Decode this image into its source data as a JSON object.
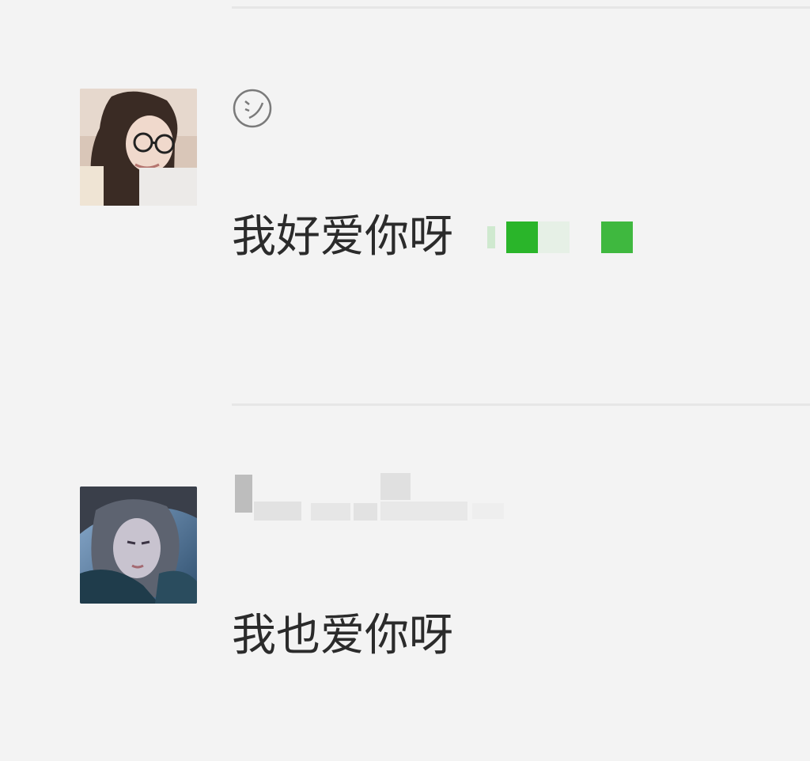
{
  "chat": {
    "messages": [
      {
        "avatar_icon": "female-avatar-icon",
        "name_icon": "smile-icon",
        "text": "我好爱你呀",
        "redacted_emoji_colors": [
          "#2ab52a",
          "#3fb83f"
        ]
      },
      {
        "avatar_icon": "male-avatar-icon",
        "name_obscured": true,
        "text": "我也爱你呀"
      }
    ]
  },
  "colors": {
    "background": "#f3f3f3",
    "divider": "#e6e6e6",
    "text": "#2b2b2b",
    "accent_green": "#2ab52a"
  }
}
